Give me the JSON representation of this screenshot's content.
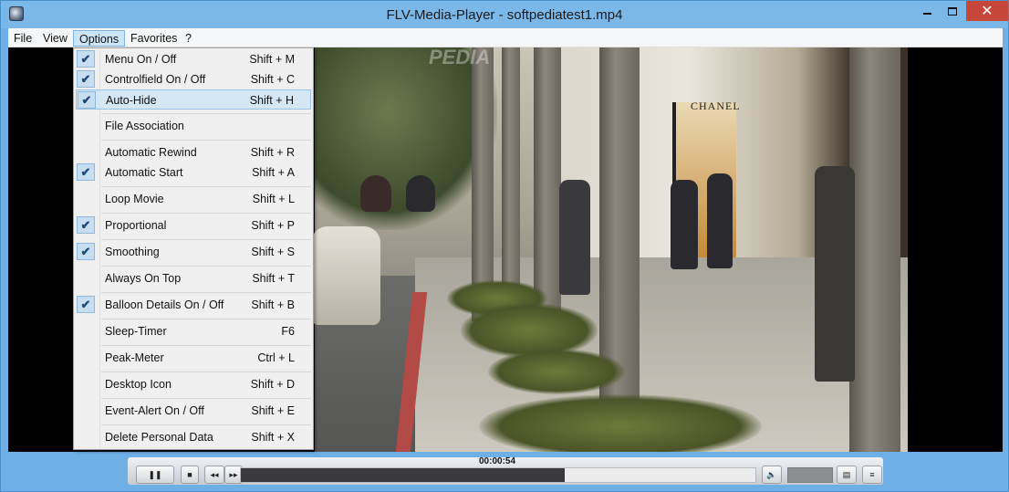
{
  "window": {
    "title": "FLV-Media-Player - softpediatest1.mp4"
  },
  "menubar": {
    "items": [
      "File",
      "View",
      "Options",
      "Favorites",
      "?"
    ],
    "active": "Options"
  },
  "options_menu": [
    {
      "label": "Menu On / Off",
      "shortcut": "Shift + M",
      "checked": true
    },
    {
      "label": "Controlfield On / Off",
      "shortcut": "Shift + C",
      "checked": true
    },
    {
      "label": "Auto-Hide",
      "shortcut": "Shift + H",
      "checked": true,
      "highlighted": true
    },
    {
      "label": "File Association",
      "shortcut": "",
      "checked": false
    },
    {
      "label": "Automatic Rewind",
      "shortcut": "Shift + R",
      "checked": false
    },
    {
      "label": "Automatic Start",
      "shortcut": "Shift + A",
      "checked": true
    },
    {
      "label": "Loop Movie",
      "shortcut": "Shift + L",
      "checked": false
    },
    {
      "label": "Proportional",
      "shortcut": "Shift + P",
      "checked": true
    },
    {
      "label": "Smoothing",
      "shortcut": "Shift + S",
      "checked": true
    },
    {
      "label": "Always On Top",
      "shortcut": "Shift + T",
      "checked": false
    },
    {
      "label": "Balloon Details On / Off",
      "shortcut": "Shift + B",
      "checked": true
    },
    {
      "label": "Sleep-Timer",
      "shortcut": "F6",
      "checked": false
    },
    {
      "label": "Peak-Meter",
      "shortcut": "Ctrl + L",
      "checked": false
    },
    {
      "label": "Desktop Icon",
      "shortcut": "Shift + D",
      "checked": false
    },
    {
      "label": "Event-Alert On / Off",
      "shortcut": "Shift + E",
      "checked": false
    },
    {
      "label": "Delete Personal Data",
      "shortcut": "Shift + X",
      "checked": false
    }
  ],
  "player": {
    "time": "00:00:54",
    "progress_fraction": 0.63,
    "store_sign": "CHANEL",
    "watermark": "PEDIA"
  },
  "colors": {
    "accent": "#6eb0e6",
    "close": "#c7463a",
    "highlight": "#d5e6f5"
  }
}
